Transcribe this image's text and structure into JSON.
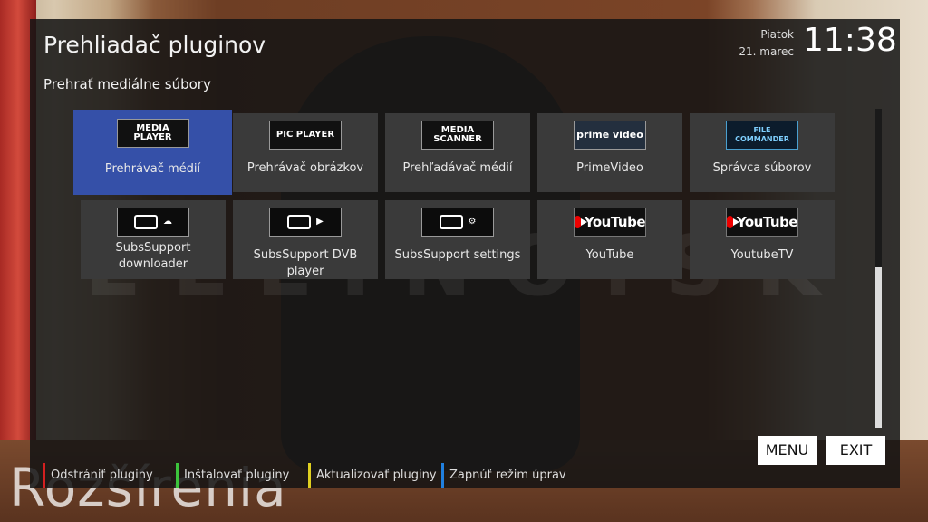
{
  "header": {
    "title": "Prehliadač pluginov",
    "subtitle": "Prehrať mediálne súbory",
    "day": "Piatok",
    "date": "21. marec",
    "time": "11:38"
  },
  "background_title": "Rozšírenia",
  "watermark": "ELLINO.SK",
  "plugins": [
    {
      "label": "Prehrávač médií",
      "logo": "MEDIA PLAYER",
      "icon": "media-player-icon",
      "selected": true
    },
    {
      "label": "Prehrávač obrázkov",
      "logo": "PIC PLAYER",
      "icon": "pic-player-icon"
    },
    {
      "label": "Prehľadávač médií",
      "logo": "MEDIA SCANNER",
      "icon": "media-scanner-icon"
    },
    {
      "label": "PrimeVideo",
      "logo": "prime video",
      "icon": "prime-video-icon"
    },
    {
      "label": "Správca súborov",
      "logo": "FILE COMMANDER",
      "icon": "file-commander-icon"
    },
    {
      "label": "SubsSupport downloader",
      "logo": "",
      "icon": "subs-download-icon"
    },
    {
      "label": "SubsSupport DVB player",
      "logo": "",
      "icon": "subs-play-icon"
    },
    {
      "label": "SubsSupport settings",
      "logo": "",
      "icon": "subs-settings-icon"
    },
    {
      "label": "YouTube",
      "logo": "YouTube",
      "icon": "youtube-icon"
    },
    {
      "label": "YoutubeTV",
      "logo": "YouTube",
      "icon": "youtube-icon"
    }
  ],
  "footer": [
    {
      "label": "Odstrániť pluginy",
      "color": "#d42020"
    },
    {
      "label": "Inštalovať pluginy",
      "color": "#3cc43c"
    },
    {
      "label": "Aktualizovať pluginy",
      "color": "#e0d020"
    },
    {
      "label": "Zapnúť režim úprav",
      "color": "#2080e0"
    }
  ],
  "buttons": {
    "menu": "MENU",
    "exit": "EXIT"
  }
}
